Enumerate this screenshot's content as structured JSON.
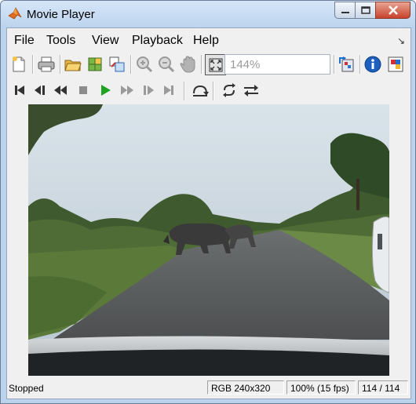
{
  "window": {
    "title": "Movie Player",
    "icon": "matlab-icon"
  },
  "menu": {
    "items": [
      "File",
      "Tools",
      "View",
      "Playback",
      "Help"
    ]
  },
  "toolbar": {
    "zoom_value": "144%"
  },
  "status": {
    "state": "Stopped",
    "format": "RGB 240x320",
    "speed": "100% (15 fps)",
    "frame": "114 / 114"
  },
  "colors": {
    "play_green": "#1fa21f",
    "accent_blue": "#1c5fbf"
  }
}
